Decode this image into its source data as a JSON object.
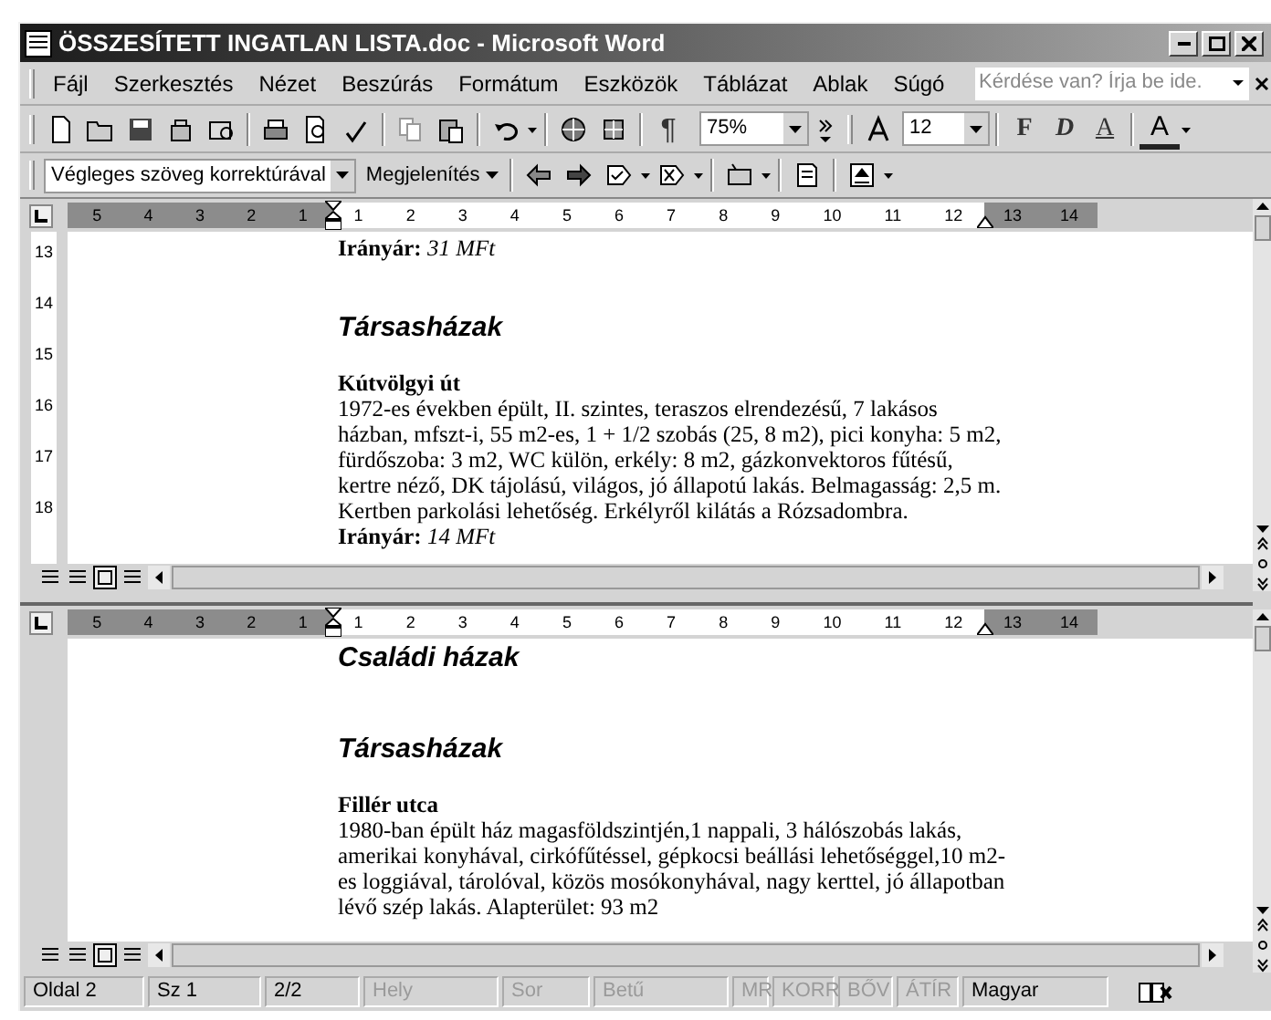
{
  "window": {
    "title": "ÖSSZESÍTETT INGATLAN LISTA.doc - Microsoft Word"
  },
  "menu": [
    "Fájl",
    "Szerkesztés",
    "Nézet",
    "Beszúrás",
    "Formátum",
    "Eszközök",
    "Táblázat",
    "Ablak",
    "Súgó"
  ],
  "help_box": {
    "placeholder": "Kérdése van? Írja be ide."
  },
  "standard_toolbar": {
    "paragraph_mark": "¶",
    "zoom": "75%",
    "font_size": "12",
    "format_buttons": [
      "F",
      "D",
      "A"
    ],
    "font_color": "A"
  },
  "review_toolbar": {
    "display_mode": "Végleges szöveg korrektúrával",
    "show_menu": "Megjelenítés"
  },
  "panes": [
    {
      "ruler": {
        "left_marks": [
          "5",
          "4",
          "3",
          "2",
          "1"
        ],
        "right_marks": [
          "1",
          "2",
          "3",
          "4",
          "5",
          "6",
          "7",
          "8",
          "9",
          "10",
          "11",
          "12",
          "13",
          "14"
        ]
      },
      "vertical_ruler": [
        "13",
        "14",
        "15",
        "16",
        "17",
        "18"
      ],
      "blocks": [
        {
          "kind": "price",
          "label": "Irányár:",
          "value": "31 MFt"
        },
        {
          "kind": "heading",
          "text": "Társasházak"
        },
        {
          "kind": "title",
          "text": "Kútvölgyi út"
        },
        {
          "kind": "body",
          "lines": [
            "1972-es években épült, II. szintes, teraszos elrendezésű, 7 lakásos",
            "házban, mfszt-i, 55 m2-es, 1 + 1/2 szobás (25, 8 m2), pici konyha: 5 m2,",
            "fürdőszoba: 3 m2, WC külön, erkély: 8 m2, gázkonvektoros fűtésű,",
            "kertre néző, DK tájolású, világos, jó állapotú lakás. Belmagasság: 2,5 m.",
            "Kertben parkolási lehetőség. Erkélyről kilátás a Rózsadombra."
          ]
        },
        {
          "kind": "price",
          "label": "Irányár:",
          "value": "14 MFt"
        }
      ]
    },
    {
      "ruler": {
        "left_marks": [
          "5",
          "4",
          "3",
          "2",
          "1"
        ],
        "right_marks": [
          "1",
          "2",
          "3",
          "4",
          "5",
          "6",
          "7",
          "8",
          "9",
          "10",
          "11",
          "12",
          "13",
          "14"
        ]
      },
      "blocks": [
        {
          "kind": "heading",
          "text": "Családi házak"
        },
        {
          "kind": "heading",
          "text": "Társasházak"
        },
        {
          "kind": "title",
          "text": "Fillér utca"
        },
        {
          "kind": "body",
          "lines": [
            "1980-ban épült ház magasföldszintjén,1 nappali, 3 hálószobás lakás,",
            "amerikai konyhával, cirkófűtéssel, gépkocsi beállási lehetőséggel,10 m2-",
            "es loggiával, tárolóval, közös mosókonyhával, nagy kerttel, jó állapotban",
            "lévő szép lakás. Alapterület: 93 m2"
          ]
        }
      ]
    }
  ],
  "status_bar": [
    {
      "text": "Oldal 2",
      "disabled": false
    },
    {
      "text": "Sz 1",
      "disabled": false
    },
    {
      "text": "2/2",
      "disabled": false
    },
    {
      "text": "Hely",
      "disabled": true
    },
    {
      "text": "Sor",
      "disabled": true
    },
    {
      "text": "Betű",
      "disabled": true
    },
    {
      "text": "MR",
      "disabled": true
    },
    {
      "text": "KORR",
      "disabled": true
    },
    {
      "text": "BŐV",
      "disabled": true
    },
    {
      "text": "ÁTÍR",
      "disabled": true
    },
    {
      "text": "Magyar",
      "disabled": false
    }
  ]
}
